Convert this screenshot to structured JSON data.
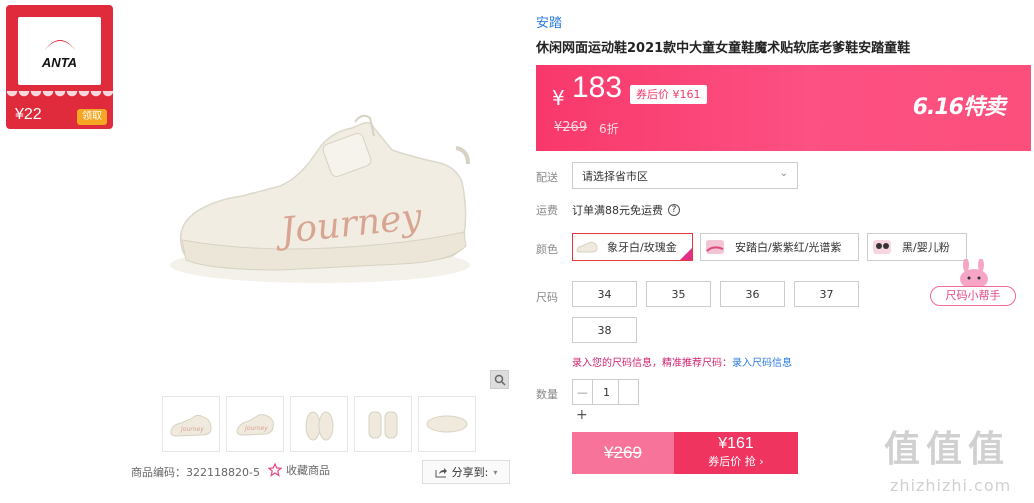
{
  "coupon": {
    "logo_text": "ANTA",
    "price": "¥22",
    "claim_label": "领取"
  },
  "gallery": {
    "zoom_icon": "magnifier-icon",
    "thumbnails": [
      "side-view",
      "angle-view",
      "front-view",
      "back-view",
      "top-view"
    ],
    "product_code_label": "商品编码：",
    "product_code": "322118820-5",
    "favorite_label": "收藏商品",
    "share_label": "分享到:"
  },
  "product": {
    "brand": "安踏",
    "title": "休闲网面运动鞋2021款中大童女童鞋魔术贴软底老爹鞋安踏童鞋"
  },
  "price_banner": {
    "currency": "¥",
    "price": "183",
    "after_coupon": "券后价 ¥161",
    "original": "¥269",
    "discount": "6折",
    "promo": "6.16特卖",
    "colors": {
      "start": "#f8386a",
      "end": "#fc4f7c"
    }
  },
  "delivery": {
    "label": "配送",
    "placeholder": "请选择省市区"
  },
  "shipping": {
    "label": "运费",
    "text": "订单满88元免运费"
  },
  "colors": {
    "label": "颜色",
    "options": [
      {
        "name": "象牙白/玫瑰金",
        "selected": true
      },
      {
        "name": "安踏白/紫紫红/光谱紫",
        "selected": false
      },
      {
        "name": "黑/婴儿粉",
        "selected": false
      }
    ]
  },
  "sizes": {
    "label": "尺码",
    "options": [
      "34",
      "35",
      "36",
      "37",
      "38"
    ],
    "helper_label": "尺码小帮手",
    "hint_text": "录入您的尺码信息，精准推荐尺码：",
    "hint_link": "录入尺码信息"
  },
  "quantity": {
    "label": "数量",
    "value": "1",
    "minus": "—",
    "plus": "+"
  },
  "buy": {
    "original_price": "¥269",
    "coupon_price": "¥161",
    "coupon_action": "券后价 抢 ›"
  },
  "watermark": {
    "chars": "值值值",
    "url": "zhizhizhi.com"
  }
}
